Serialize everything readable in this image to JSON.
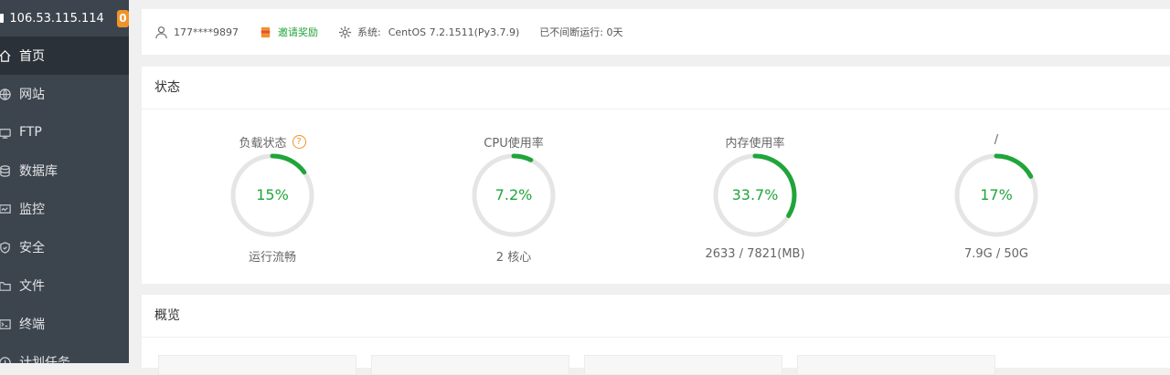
{
  "server": {
    "ip": "106.53.115.114",
    "badge": "0"
  },
  "sidebar": {
    "items": [
      {
        "label": "首页",
        "icon": "home-icon",
        "active": true
      },
      {
        "label": "网站",
        "icon": "globe-icon",
        "active": false
      },
      {
        "label": "FTP",
        "icon": "ftp-icon",
        "active": false
      },
      {
        "label": "数据库",
        "icon": "database-icon",
        "active": false
      },
      {
        "label": "监控",
        "icon": "monitor-icon",
        "active": false
      },
      {
        "label": "安全",
        "icon": "shield-icon",
        "active": false
      },
      {
        "label": "文件",
        "icon": "folder-icon",
        "active": false
      },
      {
        "label": "终端",
        "icon": "terminal-icon",
        "active": false
      },
      {
        "label": "计划任务",
        "icon": "clock-icon",
        "active": false
      }
    ]
  },
  "infobar": {
    "user": "177****9897",
    "invite": "邀请奖励",
    "system_label": "系统:",
    "system_value": "CentOS 7.2.1511(Py3.7.9)",
    "uptime": "已不间断运行: 0天"
  },
  "status": {
    "title": "状态",
    "gauges": [
      {
        "title": "负载状态",
        "help": "?",
        "value_text": "15%",
        "fraction": 0.15,
        "sub": "运行流畅"
      },
      {
        "title": "CPU使用率",
        "value_text": "7.2%",
        "fraction": 0.072,
        "sub": "2 核心"
      },
      {
        "title": "内存使用率",
        "value_text": "33.7%",
        "fraction": 0.337,
        "sub": "2633 / 7821(MB)"
      },
      {
        "title": "/",
        "value_text": "17%",
        "fraction": 0.17,
        "sub": "7.9G / 50G"
      }
    ]
  },
  "overview": {
    "title": "概览"
  },
  "colors": {
    "accent": "#20a53a",
    "ring_track": "#e5e5e5",
    "badge": "#f0932b",
    "sidebar": "#3c444d"
  }
}
